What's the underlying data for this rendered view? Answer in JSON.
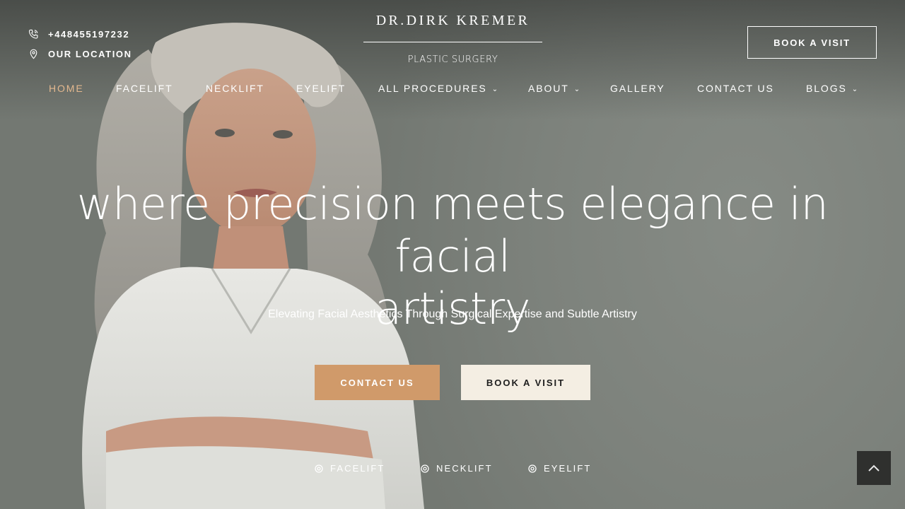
{
  "header": {
    "phone": "+448455197232",
    "location": "OUR LOCATION",
    "book_button": "BOOK A VISIT",
    "icons": {
      "phone": "phone-icon",
      "location": "map-pin-icon"
    }
  },
  "logo": {
    "name": "DR.DIRK KREMER",
    "subtitle": "PLASTIC SURGERY"
  },
  "nav": {
    "items": [
      {
        "label": "HOME",
        "active": true
      },
      {
        "label": "FACELIFT"
      },
      {
        "label": "NECKLIFT"
      },
      {
        "label": "EYELIFT"
      },
      {
        "label": "ALL PROCEDURES",
        "dropdown": true
      },
      {
        "label": "ABOUT",
        "dropdown": true
      },
      {
        "label": "GALLERY"
      },
      {
        "label": "CONTACT US"
      },
      {
        "label": "BLOGS",
        "dropdown": true
      }
    ],
    "caret": "⌄"
  },
  "hero": {
    "headline_line1": "where precision meets elegance in facial",
    "headline_line2": "artistry",
    "subline": "Elevating Facial Aesthetics Through Surgical Expertise and Subtle Artistry",
    "contact_button": "CONTACT US",
    "book_button": "BOOK A VISIT",
    "tags": [
      "FACELIFT",
      "NECKLIFT",
      "EYELIFT"
    ]
  },
  "colors": {
    "accent": "#d09a6a",
    "active_nav": "#e3b88f",
    "cream_button": "#f4eee3",
    "background": "#7a7f79"
  }
}
